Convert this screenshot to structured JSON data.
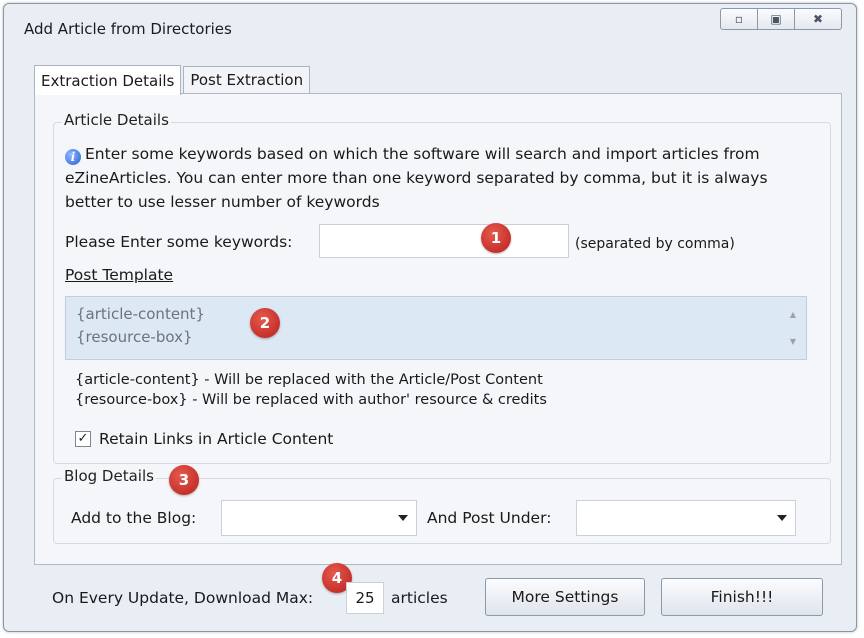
{
  "window": {
    "title": "Add Article from Directories",
    "buttons": {
      "minimize_icon": "minimize-icon",
      "maximize_icon": "maximize-icon",
      "close_icon": "close-icon"
    }
  },
  "tabs": [
    {
      "label": "Extraction Details",
      "active": true
    },
    {
      "label": "Post Extraction",
      "active": false
    }
  ],
  "article_details": {
    "group_title": "Article Details",
    "info_text": "Enter some keywords based on which the software will search and import articles from eZineArticles. You can enter more than one keyword separated by comma, but it is always better to use lesser number of keywords",
    "keywords_label": "Please Enter some keywords:",
    "keywords_value": "",
    "keywords_hint": "(separated by comma)",
    "post_template_label": "Post Template",
    "template_line1": "{article-content}",
    "template_line2": "{resource-box}",
    "note_line1": "{article-content} - Will be replaced with the Article/Post Content",
    "note_line2": "{resource-box} - Will be replaced with author' resource & credits",
    "retain_links_label": "Retain Links in Article Content",
    "retain_links_checked": true
  },
  "blog_details": {
    "group_title": "Blog Details",
    "add_to_blog_label": "Add to the Blog:",
    "add_to_blog_value": "",
    "post_under_label": "And Post Under:",
    "post_under_value": ""
  },
  "footer": {
    "download_label": "On Every Update, Download Max:",
    "max_value": "25",
    "articles_label": "articles",
    "more_settings_label": "More Settings",
    "finish_label": "Finish!!!"
  },
  "badges": [
    "1",
    "2",
    "3",
    "4"
  ],
  "colors": {
    "badge": "#c4302b",
    "template_bg": "#dde8f5",
    "window_bg": "#e9eef5"
  }
}
